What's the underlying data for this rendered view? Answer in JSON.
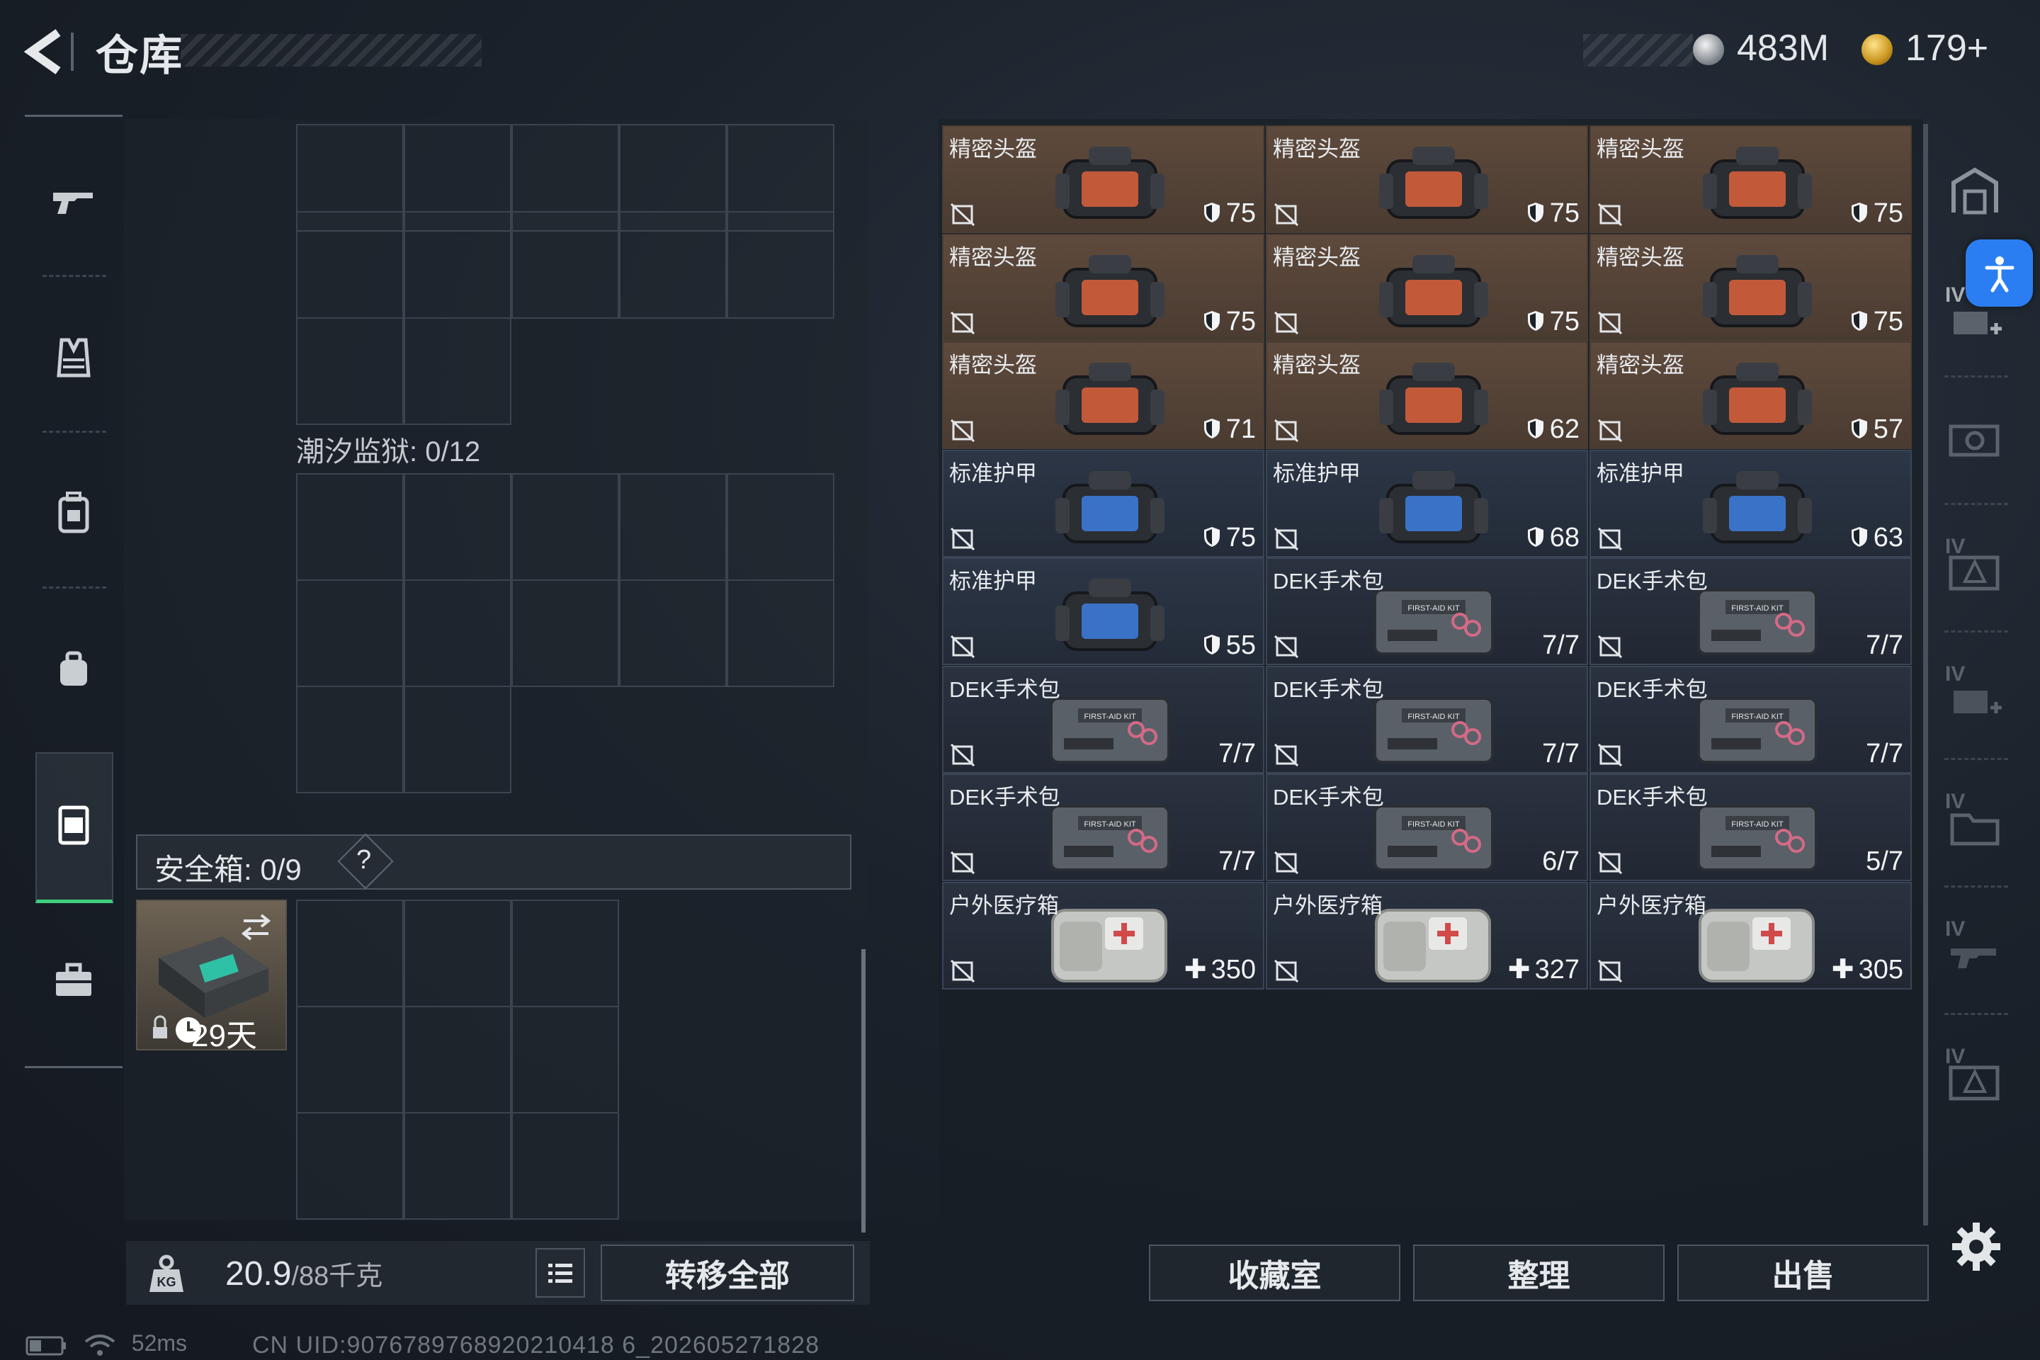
{
  "header": {
    "title": "仓库",
    "currency_silver": "483M",
    "currency_gold": "179+"
  },
  "left_panel": {
    "tide_prison_label": "潮汐监狱: 0/12",
    "safe_box_label": "安全箱: 0/9",
    "safe_box_help": "?",
    "safe_item_days": "29天"
  },
  "bottom_left": {
    "weight_value": "20.9",
    "weight_max": "/88千克",
    "transfer_all": "转移全部"
  },
  "status": {
    "ping": "52ms",
    "uid": "CN UID:9076789768920210418 6_202605271828"
  },
  "inventory": {
    "items": [
      {
        "name": "精密头盔",
        "type": "helmet",
        "value": "75",
        "icon": "shield"
      },
      {
        "name": "精密头盔",
        "type": "helmet",
        "value": "75",
        "icon": "shield"
      },
      {
        "name": "精密头盔",
        "type": "helmet",
        "value": "75",
        "icon": "shield"
      },
      {
        "name": "精密头盔",
        "type": "helmet",
        "value": "75",
        "icon": "shield"
      },
      {
        "name": "精密头盔",
        "type": "helmet",
        "value": "75",
        "icon": "shield"
      },
      {
        "name": "精密头盔",
        "type": "helmet",
        "value": "75",
        "icon": "shield"
      },
      {
        "name": "精密头盔",
        "type": "helmet",
        "value": "71",
        "icon": "shield"
      },
      {
        "name": "精密头盔",
        "type": "helmet",
        "value": "62",
        "icon": "shield"
      },
      {
        "name": "精密头盔",
        "type": "helmet",
        "value": "57",
        "icon": "shield"
      },
      {
        "name": "标准护甲",
        "type": "armor",
        "value": "75",
        "icon": "shield"
      },
      {
        "name": "标准护甲",
        "type": "armor",
        "value": "68",
        "icon": "shield"
      },
      {
        "name": "标准护甲",
        "type": "armor",
        "value": "63",
        "icon": "shield"
      },
      {
        "name": "标准护甲",
        "type": "armor",
        "value": "55",
        "icon": "shield"
      },
      {
        "name": "DEK手术包",
        "type": "medkit",
        "value": "7/7",
        "icon": "none"
      },
      {
        "name": "DEK手术包",
        "type": "medkit",
        "value": "7/7",
        "icon": "none"
      },
      {
        "name": "DEK手术包",
        "type": "medkit",
        "value": "7/7",
        "icon": "none"
      },
      {
        "name": "DEK手术包",
        "type": "medkit",
        "value": "7/7",
        "icon": "none"
      },
      {
        "name": "DEK手术包",
        "type": "medkit",
        "value": "7/7",
        "icon": "none"
      },
      {
        "name": "DEK手术包",
        "type": "medkit",
        "value": "7/7",
        "icon": "none"
      },
      {
        "name": "DEK手术包",
        "type": "medkit",
        "value": "6/7",
        "icon": "none"
      },
      {
        "name": "DEK手术包",
        "type": "medkit",
        "value": "5/7",
        "icon": "none"
      },
      {
        "name": "户外医疗箱",
        "type": "aidbox",
        "value": "350",
        "icon": "plus"
      },
      {
        "name": "户外医疗箱",
        "type": "aidbox",
        "value": "327",
        "icon": "plus"
      },
      {
        "name": "户外医疗箱",
        "type": "aidbox",
        "value": "305",
        "icon": "plus"
      }
    ]
  },
  "bottom_right": {
    "collection_room": "收藏室",
    "organize": "整理",
    "sell": "出售"
  },
  "right_rail": {
    "labels": [
      "IV",
      "IV",
      "IV",
      "IV",
      "IV",
      "IV"
    ]
  }
}
